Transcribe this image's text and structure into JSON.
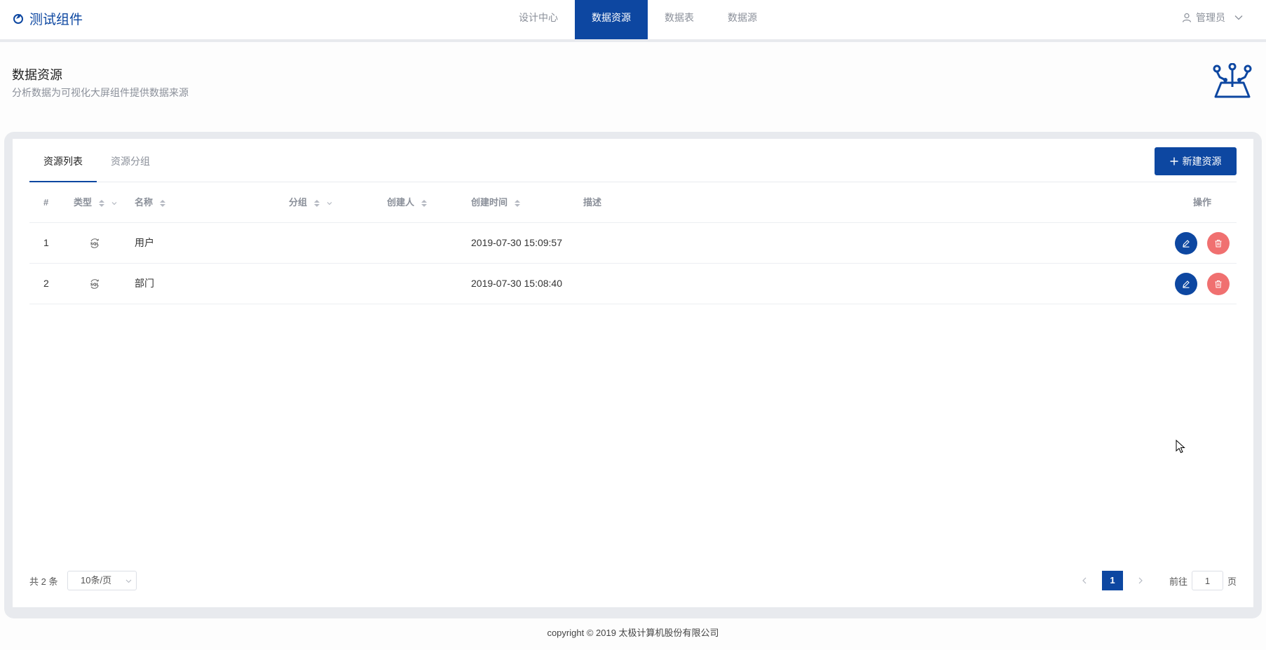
{
  "app": {
    "title": "测试组件"
  },
  "nav": {
    "tabs": [
      {
        "label": "设计中心",
        "active": false
      },
      {
        "label": "数据资源",
        "active": true
      },
      {
        "label": "数据表",
        "active": false
      },
      {
        "label": "数据源",
        "active": false
      }
    ],
    "user_label": "管理员"
  },
  "page": {
    "title": "数据资源",
    "subtitle": "分析数据为可视化大屏组件提供数据来源"
  },
  "tabs": [
    {
      "label": "资源列表",
      "active": true
    },
    {
      "label": "资源分组",
      "active": false
    }
  ],
  "new_button_label": "新建资源",
  "table": {
    "columns": {
      "idx": "#",
      "type": "类型",
      "name": "名称",
      "group": "分组",
      "creator": "创建人",
      "time": "创建时间",
      "desc": "描述",
      "ops": "操作"
    },
    "rows": [
      {
        "idx": "1",
        "type_icon": "sql-icon",
        "name": "用户",
        "group": "",
        "creator": "",
        "time": "2019-07-30 15:09:57",
        "desc": ""
      },
      {
        "idx": "2",
        "type_icon": "sql-icon",
        "name": "部门",
        "group": "",
        "creator": "",
        "time": "2019-07-30 15:08:40",
        "desc": ""
      }
    ]
  },
  "pagination": {
    "total_text": "共 2 条",
    "page_size": "10条/页",
    "current_page": "1",
    "goto_label": "前往",
    "goto_value": "1",
    "page_unit": "页"
  },
  "footer": {
    "copyright": "copyright © 2019 太极计算机股份有限公司"
  },
  "colors": {
    "primary": "#0d47a1",
    "danger": "#f07070"
  }
}
